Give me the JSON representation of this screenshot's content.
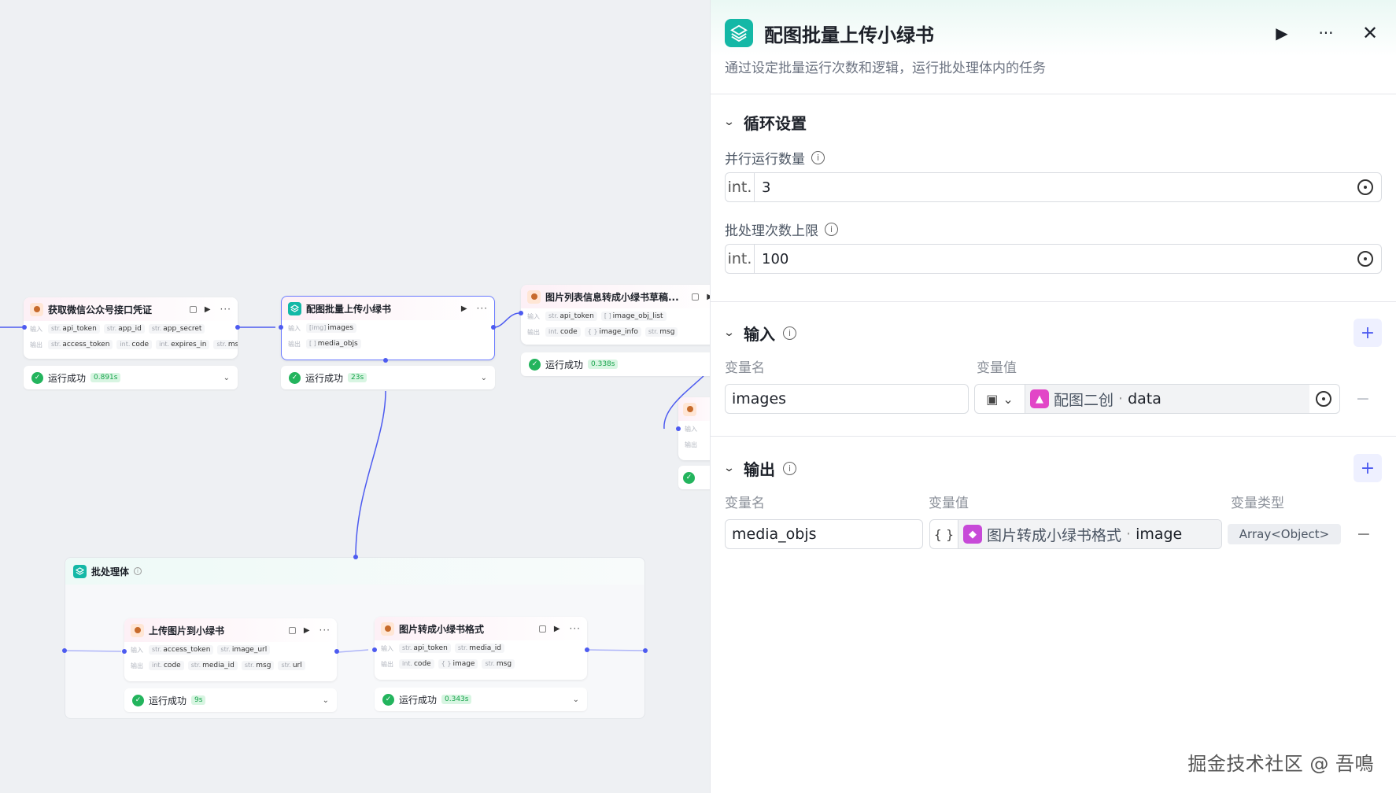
{
  "canvas": {
    "nodes": {
      "wechat": {
        "title": "获取微信公众号接口凭证",
        "input_label": "输入",
        "output_label": "输出",
        "inputs": [
          {
            "type": "str.",
            "name": "api_token"
          },
          {
            "type": "str.",
            "name": "app_id"
          },
          {
            "type": "str.",
            "name": "app_secret"
          }
        ],
        "outputs": [
          {
            "type": "str.",
            "name": "access_token"
          },
          {
            "type": "int.",
            "name": "code"
          },
          {
            "type": "int.",
            "name": "expires_in"
          },
          {
            "type": "str.",
            "name": "msg"
          }
        ],
        "status": "运行成功",
        "time": "0.891s"
      },
      "batch_upload": {
        "title": "配图批量上传小绿书",
        "input_label": "输入",
        "output_label": "输出",
        "inputs": [
          {
            "type": "[img]",
            "name": "images"
          }
        ],
        "outputs": [
          {
            "type": "[ ]",
            "name": "media_objs"
          }
        ],
        "status": "运行成功",
        "time": "23s"
      },
      "list_to_draft": {
        "title": "图片列表信息转成小绿书草稿...",
        "input_label": "输入",
        "output_label": "输出",
        "inputs": [
          {
            "type": "str.",
            "name": "api_token"
          },
          {
            "type": "[ ]",
            "name": "image_obj_list"
          }
        ],
        "outputs": [
          {
            "type": "int.",
            "name": "code"
          },
          {
            "type": "{ }",
            "name": "image_info"
          },
          {
            "type": "str.",
            "name": "msg"
          }
        ],
        "status": "运行成功",
        "time": "0.338s"
      },
      "partial": {
        "in_label": "输入",
        "out_label": "输出"
      },
      "batch_body": {
        "title": "批处理体"
      },
      "upload_img": {
        "title": "上传图片到小绿书",
        "input_label": "输入",
        "output_label": "输出",
        "inputs": [
          {
            "type": "str.",
            "name": "access_token"
          },
          {
            "type": "str.",
            "name": "image_url"
          }
        ],
        "outputs": [
          {
            "type": "int.",
            "name": "code"
          },
          {
            "type": "str.",
            "name": "media_id"
          },
          {
            "type": "str.",
            "name": "msg"
          },
          {
            "type": "str.",
            "name": "url"
          }
        ],
        "status": "运行成功",
        "time": "9s"
      },
      "to_format": {
        "title": "图片转成小绿书格式",
        "input_label": "输入",
        "output_label": "输出",
        "inputs": [
          {
            "type": "str.",
            "name": "api_token"
          },
          {
            "type": "str.",
            "name": "media_id"
          }
        ],
        "outputs": [
          {
            "type": "int.",
            "name": "code"
          },
          {
            "type": "{ }",
            "name": "image"
          },
          {
            "type": "str.",
            "name": "msg"
          }
        ],
        "status": "运行成功",
        "time": "0.343s"
      }
    }
  },
  "panel": {
    "title": "配图批量上传小绿书",
    "description": "通过设定批量运行次数和逻辑，运行批处理体内的任务",
    "loop": {
      "title": "循环设置",
      "parallel_label": "并行运行数量",
      "parallel_type": "int.",
      "parallel_value": "3",
      "limit_label": "批处理次数上限",
      "limit_type": "int.",
      "limit_value": "100"
    },
    "input": {
      "title": "输入",
      "col_name": "变量名",
      "col_value": "变量值",
      "rows": [
        {
          "name": "images",
          "ref_node": "配图二创",
          "ref_sep": "·",
          "ref_var": "data"
        }
      ]
    },
    "output": {
      "title": "输出",
      "col_name": "变量名",
      "col_value": "变量值",
      "col_type": "变量类型",
      "rows": [
        {
          "name": "media_objs",
          "type_glyph": "{ }",
          "ref_node": "图片转成小绿书格式",
          "ref_sep": "·",
          "ref_var": "image",
          "var_type": "Array<Object>"
        }
      ]
    }
  },
  "watermark": "掘金技术社区 @ 吾鳴",
  "colors": {
    "accent": "#4d5bf0",
    "batch_icon": "#14b8a6",
    "success": "#23b45d",
    "ref_badge": "#e246c7"
  }
}
